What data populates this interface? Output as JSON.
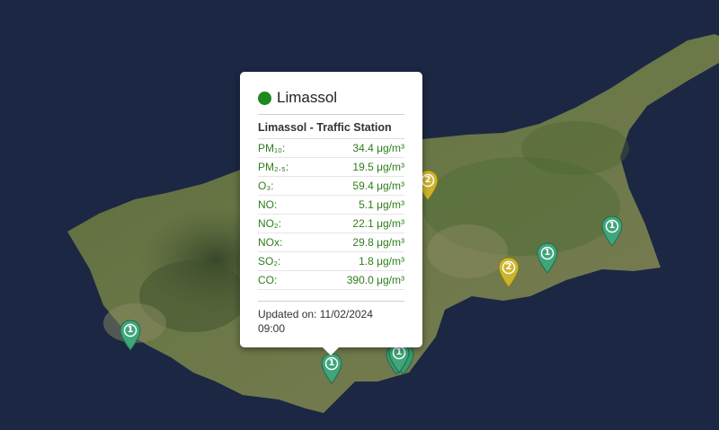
{
  "markers": [
    {
      "count": "2",
      "color": "#cbb52f",
      "id": "nicosia"
    },
    {
      "count": "1",
      "color": "#3fa57a",
      "id": "paralimni"
    },
    {
      "count": "1",
      "color": "#3fa57a",
      "id": "ayia-napa"
    },
    {
      "count": "2",
      "color": "#cbb52f",
      "id": "larnaca"
    },
    {
      "count": "1",
      "color": "#3fa57a",
      "id": "paphos"
    },
    {
      "count": "1",
      "color": "#3fa57a",
      "id": "limassol"
    },
    {
      "count": "1",
      "color": "#3fa57a",
      "id": "limassol-east"
    }
  ],
  "popup": {
    "city": "Limassol",
    "status_color": "#1b8a1f",
    "station": "Limassol - Traffic Station",
    "rows": [
      {
        "label": "PM₁₀:",
        "value": "34.4 μg/m³"
      },
      {
        "label": "PM₂.₅:",
        "value": "19.5 μg/m³"
      },
      {
        "label": "O₃:",
        "value": "59.4 μg/m³"
      },
      {
        "label": "NO:",
        "value": "5.1 μg/m³"
      },
      {
        "label": "NO₂:",
        "value": "22.1 μg/m³"
      },
      {
        "label": "NOx:",
        "value": "29.8 μg/m³"
      },
      {
        "label": "SO₂:",
        "value": "1.8 μg/m³"
      },
      {
        "label": "CO:",
        "value": "390.0 μg/m³"
      }
    ],
    "updated_label": "Updated on:",
    "updated_date": "11/02/2024",
    "updated_time": "09:00"
  }
}
